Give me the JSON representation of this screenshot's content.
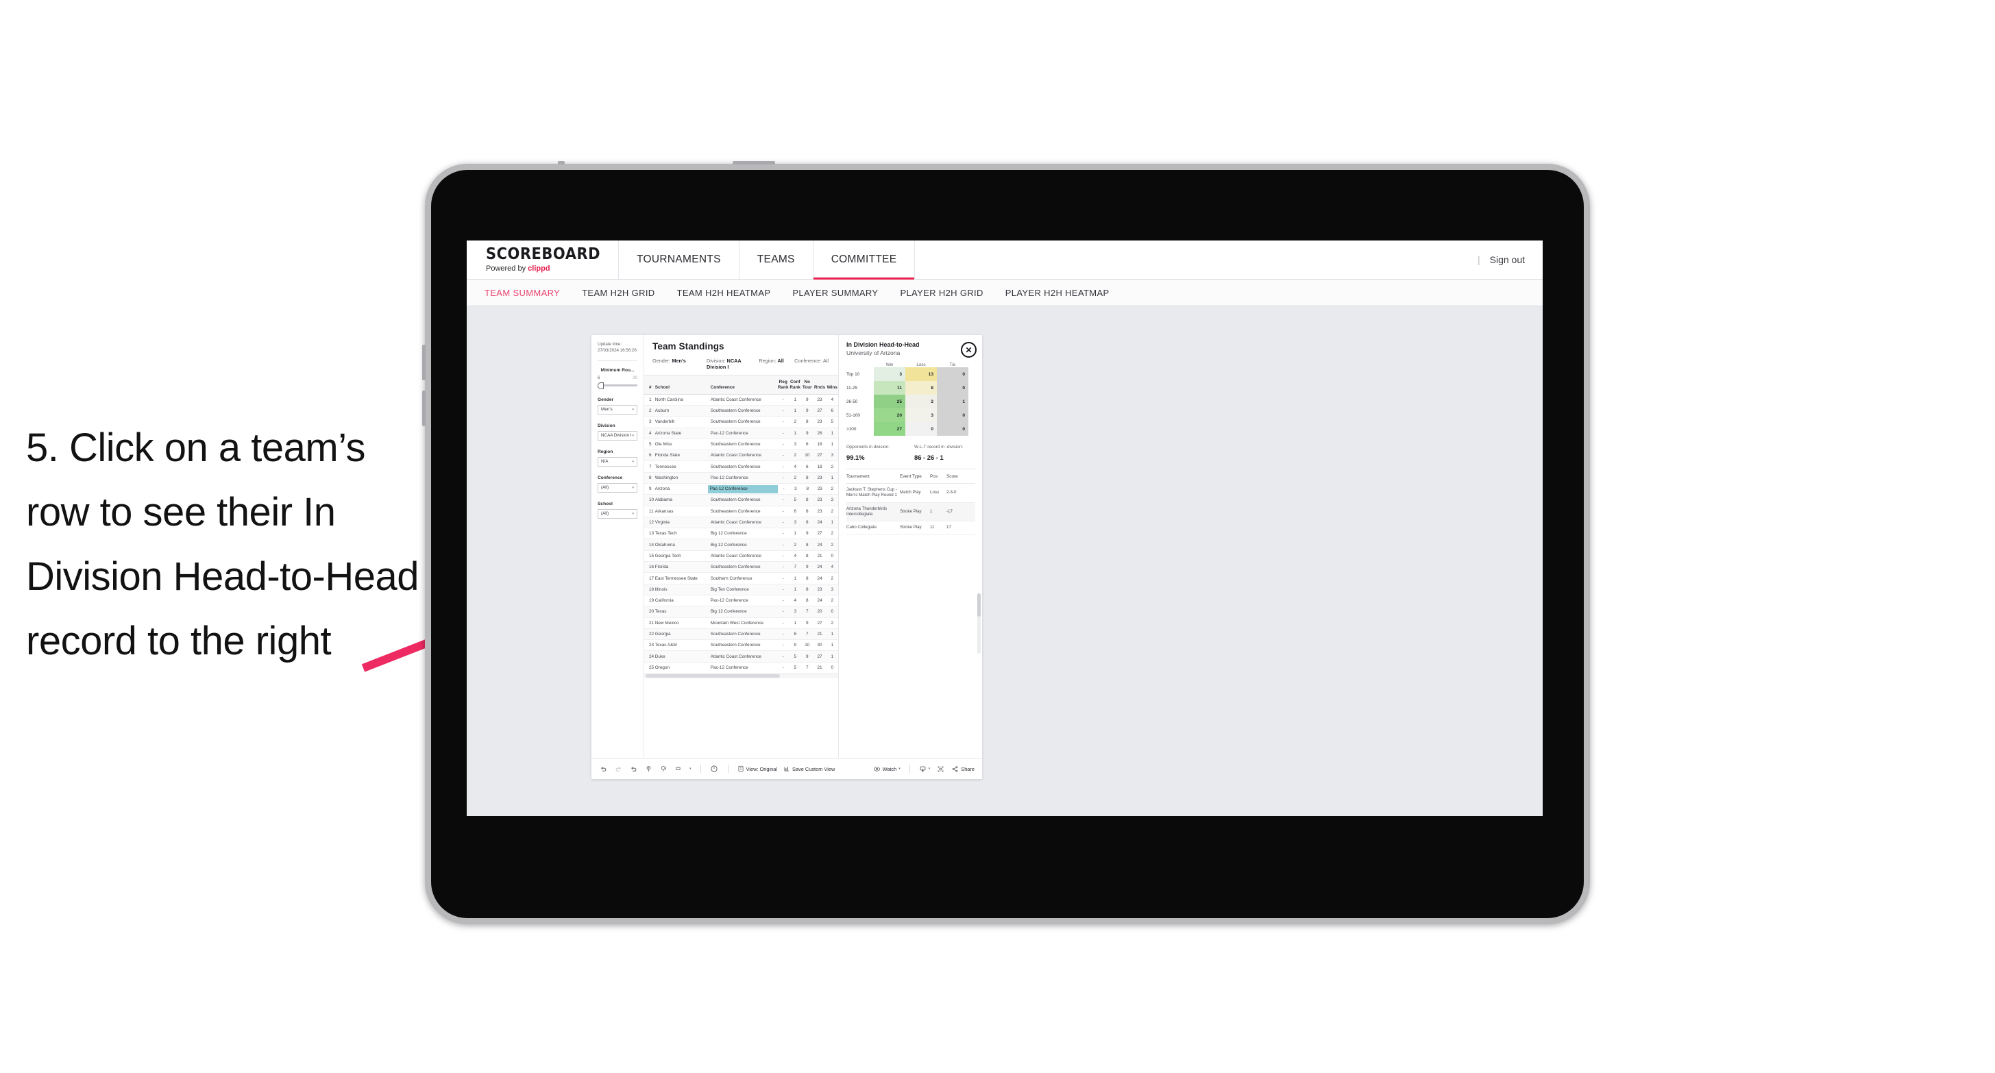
{
  "instruction": {
    "text": "5. Click on a team’s row to see their In Division Head-to-Head record to the right"
  },
  "colors": {
    "accent": "#e81f4e",
    "arrow": "#ee2a62",
    "selected_row": "#8fcdd8",
    "device_bezel": "#0a0a0a",
    "device_frame": "#b9b9bc",
    "app_bg": "#e8eaee"
  },
  "topnav": {
    "brand_title": "SCOREBOARD",
    "brand_sub_prefix": "Powered by ",
    "brand_sub_accent": "clippd",
    "items": [
      {
        "label": "TOURNAMENTS",
        "active": false
      },
      {
        "label": "TEAMS",
        "active": false
      },
      {
        "label": "COMMITTEE",
        "active": true
      }
    ],
    "divider": "|",
    "signout": "Sign out"
  },
  "subnav": {
    "items": [
      {
        "label": "TEAM SUMMARY",
        "active": true
      },
      {
        "label": "TEAM H2H GRID",
        "active": false
      },
      {
        "label": "TEAM H2H HEATMAP",
        "active": false
      },
      {
        "label": "PLAYER SUMMARY",
        "active": false
      },
      {
        "label": "PLAYER H2H GRID",
        "active": false
      },
      {
        "label": "PLAYER H2H HEATMAP",
        "active": false
      }
    ]
  },
  "filters": {
    "update_label": "Update time:",
    "update_value": "27/03/2024 16:56:26",
    "slider": {
      "title": "Minimum Rou...",
      "min": "6",
      "max": "30"
    },
    "selects": [
      {
        "label": "Gender",
        "value": "Men’s"
      },
      {
        "label": "Division",
        "value": "NCAA Division I"
      },
      {
        "label": "Region",
        "value": "N/A"
      },
      {
        "label": "Conference",
        "value": "(All)"
      },
      {
        "label": "School",
        "value": "(All)"
      }
    ],
    "caret": "▾"
  },
  "standings": {
    "title": "Team Standings",
    "meta": [
      {
        "key": "Gender:",
        "value": "Men’s"
      },
      {
        "key": "Division:",
        "value": "NCAA Division I"
      },
      {
        "key": "Region:",
        "value": "All"
      },
      {
        "key": "Conference:",
        "value": "All"
      }
    ],
    "columns": [
      "#",
      "School",
      "Conference",
      "Reg Rank",
      "Conf Rank",
      "No Tour",
      "Rnds",
      "Wins"
    ],
    "columns_display": [
      {
        "l1": "#",
        "l2": ""
      },
      {
        "l1": "School",
        "l2": ""
      },
      {
        "l1": "Conference",
        "l2": ""
      },
      {
        "l1": "Reg",
        "l2": "Rank"
      },
      {
        "l1": "Conf",
        "l2": "Rank"
      },
      {
        "l1": "No",
        "l2": "Tour"
      },
      {
        "l1": "Rnds",
        "l2": ""
      },
      {
        "l1": "Wins",
        "l2": ""
      }
    ],
    "rows": [
      {
        "n": "1",
        "school": "North Carolina",
        "conf": "Atlantic Coast Conference",
        "reg": "-",
        "cr": "1",
        "nt": "9",
        "rn": "23",
        "wn": "4",
        "selected": false
      },
      {
        "n": "2",
        "school": "Auburn",
        "conf": "Southeastern Conference",
        "reg": "-",
        "cr": "1",
        "nt": "9",
        "rn": "27",
        "wn": "6",
        "selected": false
      },
      {
        "n": "3",
        "school": "Vanderbilt",
        "conf": "Southeastern Conference",
        "reg": "-",
        "cr": "2",
        "nt": "8",
        "rn": "23",
        "wn": "5",
        "selected": false
      },
      {
        "n": "4",
        "school": "Arizona State",
        "conf": "Pac-12 Conference",
        "reg": "-",
        "cr": "1",
        "nt": "9",
        "rn": "26",
        "wn": "1",
        "selected": false
      },
      {
        "n": "5",
        "school": "Ole Miss",
        "conf": "Southeastern Conference",
        "reg": "-",
        "cr": "3",
        "nt": "6",
        "rn": "18",
        "wn": "1",
        "selected": false
      },
      {
        "n": "6",
        "school": "Florida State",
        "conf": "Atlantic Coast Conference",
        "reg": "-",
        "cr": "2",
        "nt": "10",
        "rn": "27",
        "wn": "3",
        "selected": false
      },
      {
        "n": "7",
        "school": "Tennessee",
        "conf": "Southeastern Conference",
        "reg": "-",
        "cr": "4",
        "nt": "6",
        "rn": "18",
        "wn": "2",
        "selected": false
      },
      {
        "n": "8",
        "school": "Washington",
        "conf": "Pac-12 Conference",
        "reg": "-",
        "cr": "2",
        "nt": "8",
        "rn": "23",
        "wn": "1",
        "selected": false
      },
      {
        "n": "9",
        "school": "Arizona",
        "conf": "Pac-12 Conference",
        "reg": "-",
        "cr": "3",
        "nt": "8",
        "rn": "23",
        "wn": "2",
        "selected": true
      },
      {
        "n": "10",
        "school": "Alabama",
        "conf": "Southeastern Conference",
        "reg": "-",
        "cr": "5",
        "nt": "8",
        "rn": "23",
        "wn": "3",
        "selected": false
      },
      {
        "n": "11",
        "school": "Arkansas",
        "conf": "Southeastern Conference",
        "reg": "-",
        "cr": "6",
        "nt": "8",
        "rn": "23",
        "wn": "2",
        "selected": false
      },
      {
        "n": "12",
        "school": "Virginia",
        "conf": "Atlantic Coast Conference",
        "reg": "-",
        "cr": "3",
        "nt": "8",
        "rn": "24",
        "wn": "1",
        "selected": false
      },
      {
        "n": "13",
        "school": "Texas Tech",
        "conf": "Big 12 Conference",
        "reg": "-",
        "cr": "1",
        "nt": "9",
        "rn": "27",
        "wn": "2",
        "selected": false
      },
      {
        "n": "14",
        "school": "Oklahoma",
        "conf": "Big 12 Conference",
        "reg": "-",
        "cr": "2",
        "nt": "8",
        "rn": "24",
        "wn": "2",
        "selected": false
      },
      {
        "n": "15",
        "school": "Georgia Tech",
        "conf": "Atlantic Coast Conference",
        "reg": "-",
        "cr": "4",
        "nt": "8",
        "rn": "21",
        "wn": "0",
        "selected": false
      },
      {
        "n": "16",
        "school": "Florida",
        "conf": "Southeastern Conference",
        "reg": "-",
        "cr": "7",
        "nt": "9",
        "rn": "24",
        "wn": "4",
        "selected": false
      },
      {
        "n": "17",
        "school": "East Tennessee State",
        "conf": "Southern Conference",
        "reg": "-",
        "cr": "1",
        "nt": "8",
        "rn": "24",
        "wn": "2",
        "selected": false
      },
      {
        "n": "18",
        "school": "Illinois",
        "conf": "Big Ten Conference",
        "reg": "-",
        "cr": "1",
        "nt": "8",
        "rn": "23",
        "wn": "3",
        "selected": false
      },
      {
        "n": "19",
        "school": "California",
        "conf": "Pac-12 Conference",
        "reg": "-",
        "cr": "4",
        "nt": "8",
        "rn": "24",
        "wn": "2",
        "selected": false
      },
      {
        "n": "20",
        "school": "Texas",
        "conf": "Big 12 Conference",
        "reg": "-",
        "cr": "3",
        "nt": "7",
        "rn": "20",
        "wn": "0",
        "selected": false
      },
      {
        "n": "21",
        "school": "New Mexico",
        "conf": "Mountain West Conference",
        "reg": "-",
        "cr": "1",
        "nt": "9",
        "rn": "27",
        "wn": "2",
        "selected": false
      },
      {
        "n": "22",
        "school": "Georgia",
        "conf": "Southeastern Conference",
        "reg": "-",
        "cr": "8",
        "nt": "7",
        "rn": "21",
        "wn": "1",
        "selected": false
      },
      {
        "n": "23",
        "school": "Texas A&M",
        "conf": "Southeastern Conference",
        "reg": "-",
        "cr": "9",
        "nt": "10",
        "rn": "30",
        "wn": "1",
        "selected": false
      },
      {
        "n": "24",
        "school": "Duke",
        "conf": "Atlantic Coast Conference",
        "reg": "-",
        "cr": "5",
        "nt": "9",
        "rn": "27",
        "wn": "1",
        "selected": false
      },
      {
        "n": "25",
        "school": "Oregon",
        "conf": "Pac-12 Conference",
        "reg": "-",
        "cr": "5",
        "nt": "7",
        "rn": "21",
        "wn": "0",
        "selected": false
      }
    ]
  },
  "h2h": {
    "title": "In Division Head-to-Head",
    "subtitle": "University of Arizona",
    "close_icon": "✕",
    "heatmap": {
      "columns": [
        "Win",
        "Loss",
        "Tie"
      ],
      "rows": [
        {
          "label": "Top 10",
          "win": "3",
          "loss": "13",
          "tie": "0",
          "win_color": "#e2efe2",
          "loss_color": "#f2e39a",
          "tie_color": "#d2d2d2"
        },
        {
          "label": "11-25",
          "win": "11",
          "loss": "8",
          "tie": "0",
          "win_color": "#c8e6be",
          "loss_color": "#f5eecd",
          "tie_color": "#d2d2d2"
        },
        {
          "label": "26-50",
          "win": "25",
          "loss": "2",
          "tie": "1",
          "win_color": "#8fd086",
          "loss_color": "#f0f0e9",
          "tie_color": "#d2d2d2"
        },
        {
          "label": "51-100",
          "win": "20",
          "loss": "3",
          "tie": "0",
          "win_color": "#9ad88d",
          "loss_color": "#f2f1ea",
          "tie_color": "#d2d2d2"
        },
        {
          "label": ">100",
          "win": "27",
          "loss": "0",
          "tie": "0",
          "win_color": "#90d686",
          "loss_color": "#f1f1f1",
          "tie_color": "#d2d2d2"
        }
      ]
    },
    "stats": [
      {
        "key": "Opponents in division:",
        "value": "99.1%"
      },
      {
        "key": "W-L-T record in -division:",
        "value": "86 - 26 - 1"
      }
    ],
    "tournaments": {
      "columns": [
        "Tournament",
        "Event Type",
        "Pos",
        "Score"
      ],
      "rows": [
        {
          "t": "Jackson T. Stephens Cup - Men’s Match Play Round 1",
          "e": "Match Play",
          "p": "Loss",
          "s": "2-3-0"
        },
        {
          "t": "Arizona Thunderbirds Intercollegiate",
          "e": "Stroke Play",
          "p": "1",
          "s": "-17"
        },
        {
          "t": "Cabo Collegiate",
          "e": "Stroke Play",
          "p": "11",
          "s": "17"
        }
      ]
    }
  },
  "toolbar": {
    "view_label": "View: Original",
    "save_label": "Save Custom View",
    "watch_label": "Watch",
    "share_label": "Share",
    "caret": "▾"
  }
}
